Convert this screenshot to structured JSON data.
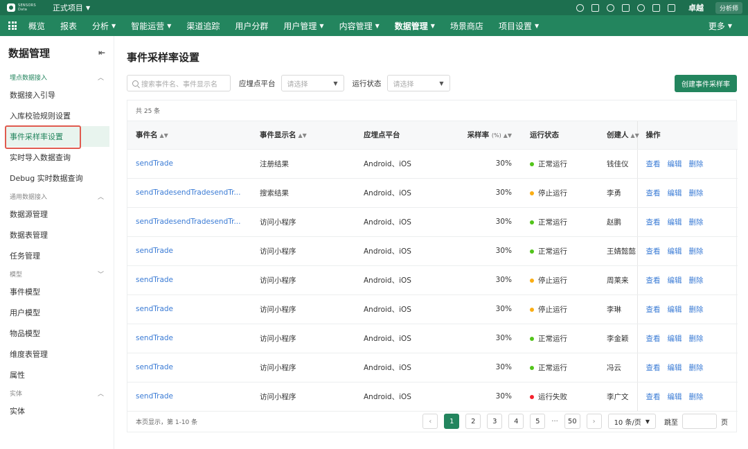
{
  "topbar": {
    "logo_text": [
      "SENSORS",
      "Data"
    ],
    "project": "正式项目",
    "user": "卓越",
    "role": "分析师"
  },
  "navbar": {
    "items": [
      {
        "label": "概览",
        "caret": false,
        "active": false
      },
      {
        "label": "报表",
        "caret": false,
        "active": false
      },
      {
        "label": "分析",
        "caret": true,
        "active": false
      },
      {
        "label": "智能运营",
        "caret": true,
        "active": false
      },
      {
        "label": "渠道追踪",
        "caret": false,
        "active": false
      },
      {
        "label": "用户分群",
        "caret": false,
        "active": false
      },
      {
        "label": "用户管理",
        "caret": true,
        "active": false
      },
      {
        "label": "内容管理",
        "caret": true,
        "active": false
      },
      {
        "label": "数据管理",
        "caret": true,
        "active": true
      },
      {
        "label": "场景商店",
        "caret": false,
        "active": false
      },
      {
        "label": "项目设置",
        "caret": true,
        "active": false
      }
    ],
    "more": "更多"
  },
  "sidebar": {
    "title": "数据管理",
    "groups": [
      {
        "label": "埋点数据接入",
        "items": [
          "数据接入引导",
          "入库校验规则设置",
          "事件采样率设置",
          "实时导入数据查询",
          "Debug 实时数据查询"
        ]
      },
      {
        "label": "通用数据接入",
        "items": [
          "数据源管理",
          "数据表管理",
          "任务管理"
        ]
      },
      {
        "label": "模型",
        "items": [
          "事件模型",
          "用户模型",
          "物品模型",
          "维度表管理",
          "属性"
        ]
      },
      {
        "label": "实体",
        "items": [
          "实体"
        ]
      }
    ],
    "active_item": "事件采样率设置"
  },
  "main": {
    "title": "事件采样率设置",
    "search_placeholder": "搜索事件名、事件显示名",
    "filter_platform_label": "应埋点平台",
    "filter_platform_placeholder": "请选择",
    "filter_status_label": "运行状态",
    "filter_status_placeholder": "请选择",
    "create_button": "创建事件采样率",
    "count_text": "共 25 条",
    "columns": {
      "event_name": "事件名",
      "display_name": "事件显示名",
      "platform": "应埋点平台",
      "rate": "采样率",
      "rate_unit": "(%)",
      "status": "运行状态",
      "creator": "创建人",
      "ops": "操作"
    },
    "op_labels": {
      "view": "查看",
      "edit": "编辑",
      "delete": "删除"
    },
    "rows": [
      {
        "event": "sendTrade",
        "display": "注册结果",
        "platform": "Android、iOS",
        "rate": "30%",
        "status": "正常运行",
        "status_color": "#52c41a",
        "creator": "钱佳仪"
      },
      {
        "event": "sendTradesendTradesendTr...",
        "display": "搜索结果",
        "platform": "Android、iOS",
        "rate": "30%",
        "status": "停止运行",
        "status_color": "#faad14",
        "creator": "李勇"
      },
      {
        "event": "sendTradesendTradesendTr...",
        "display": "访问小程序",
        "platform": "Android、iOS",
        "rate": "30%",
        "status": "正常运行",
        "status_color": "#52c41a",
        "creator": "赵鹏"
      },
      {
        "event": "sendTrade",
        "display": "访问小程序",
        "platform": "Android、iOS",
        "rate": "30%",
        "status": "正常运行",
        "status_color": "#52c41a",
        "creator": "王婧懿懿"
      },
      {
        "event": "sendTrade",
        "display": "访问小程序",
        "platform": "Android、iOS",
        "rate": "30%",
        "status": "停止运行",
        "status_color": "#faad14",
        "creator": "周莱来"
      },
      {
        "event": "sendTrade",
        "display": "访问小程序",
        "platform": "Android、iOS",
        "rate": "30%",
        "status": "停止运行",
        "status_color": "#faad14",
        "creator": "李琳"
      },
      {
        "event": "sendTrade",
        "display": "访问小程序",
        "platform": "Android、iOS",
        "rate": "30%",
        "status": "正常运行",
        "status_color": "#52c41a",
        "creator": "李金颖"
      },
      {
        "event": "sendTrade",
        "display": "访问小程序",
        "platform": "Android、iOS",
        "rate": "30%",
        "status": "正常运行",
        "status_color": "#52c41a",
        "creator": "冯云"
      },
      {
        "event": "sendTrade",
        "display": "访问小程序",
        "platform": "Android、iOS",
        "rate": "30%",
        "status": "运行失败",
        "status_color": "#f5222d",
        "creator": "李广文"
      }
    ],
    "pagination": {
      "info": "本页显示，第 1-10 条",
      "pages": [
        "1",
        "2",
        "3",
        "4",
        "5"
      ],
      "ellipsis": "···",
      "last_page": "50",
      "current": "1",
      "page_size": "10 条/页",
      "jump_label": "跳至",
      "page_word": "页"
    }
  },
  "colors": {
    "brand": "#23855e",
    "topbar": "#1d6f4f",
    "link": "#3a7bd5",
    "highlight_box": "#e05a4e"
  }
}
